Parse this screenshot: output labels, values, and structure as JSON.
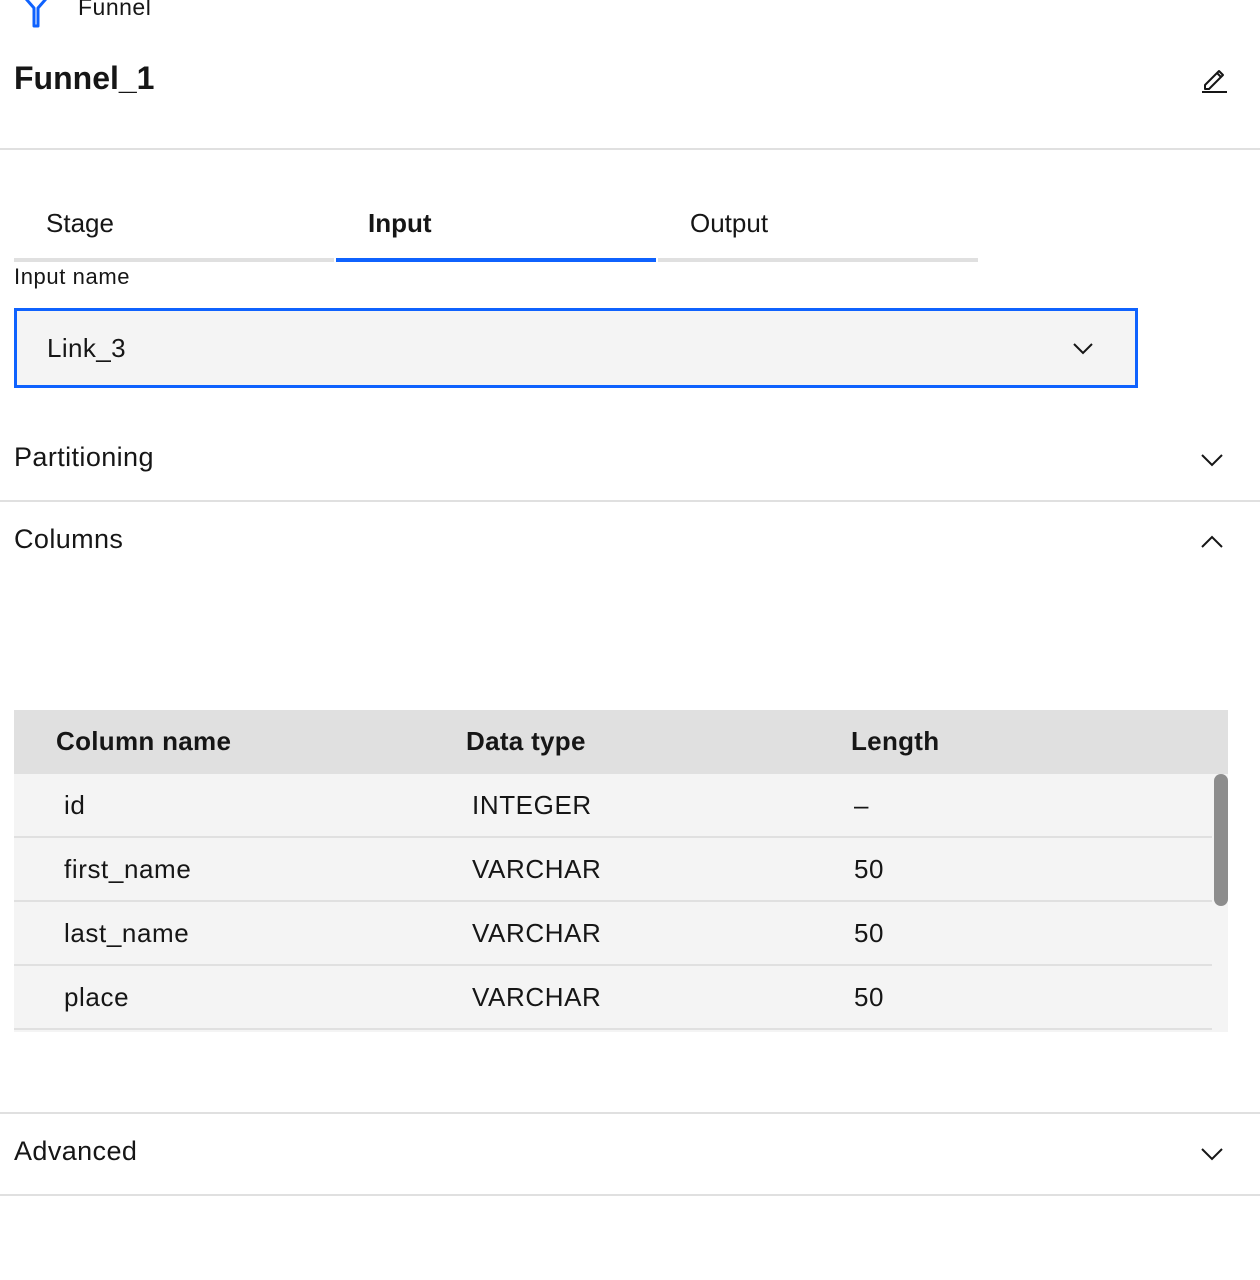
{
  "header": {
    "stage_type": "Funnel",
    "title": "Funnel_1",
    "icon": "funnel-icon",
    "edit_icon": "pencil-icon"
  },
  "tabs": [
    {
      "label": "Stage",
      "active": false
    },
    {
      "label": "Input",
      "active": true
    },
    {
      "label": "Output",
      "active": false
    }
  ],
  "input_name": {
    "label": "Input name",
    "value": "Link_3"
  },
  "sections": {
    "partitioning": {
      "label": "Partitioning",
      "expanded": false
    },
    "columns": {
      "label": "Columns",
      "expanded": true
    },
    "advanced": {
      "label": "Advanced",
      "expanded": false
    }
  },
  "columns_table": {
    "headers": [
      "Column name",
      "Data type",
      "Length"
    ],
    "rows": [
      [
        "id",
        "INTEGER",
        "–"
      ],
      [
        "first_name",
        "VARCHAR",
        "50"
      ],
      [
        "last_name",
        "VARCHAR",
        "50"
      ],
      [
        "place",
        "VARCHAR",
        "50"
      ]
    ]
  },
  "colors": {
    "accent": "#0f62fe",
    "field_bg": "#f4f4f4",
    "header_bg": "#e0e0e0",
    "text": "#161616"
  }
}
